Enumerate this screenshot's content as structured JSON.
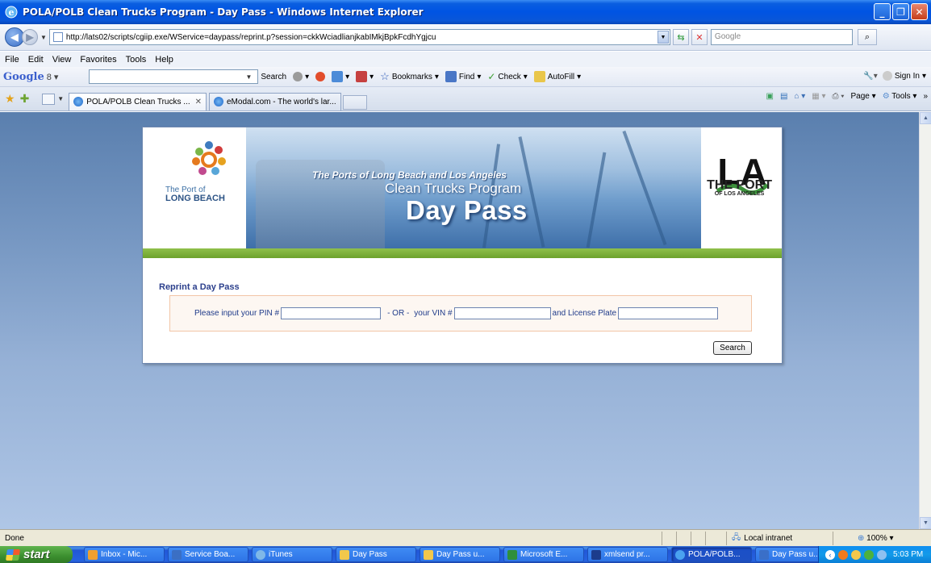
{
  "window": {
    "title": "POLA/POLB Clean Trucks Program - Day Pass - Windows Internet Explorer",
    "controls": [
      "minimize",
      "restore",
      "close"
    ]
  },
  "address": {
    "url": "http://lats02/scripts/cgiip.exe/WService=daypass/reprint.p?session=ckkWciadlianjkabIMkjBpkFcdhYgjcu",
    "search_placeholder": "Google"
  },
  "menu": [
    "File",
    "Edit",
    "View",
    "Favorites",
    "Tools",
    "Help"
  ],
  "google_toolbar": {
    "logo": "Google",
    "items": [
      "Search",
      "Bookmarks",
      "Find",
      "Check",
      "AutoFill"
    ],
    "sign_in": "Sign In"
  },
  "tabs": [
    {
      "label": "POLA/POLB Clean Trucks ...",
      "active": true
    },
    {
      "label": "eModal.com - The world's lar...",
      "active": false
    }
  ],
  "command_bar": [
    "Page",
    "Tools"
  ],
  "banner": {
    "left_logo_line1": "The Port of",
    "left_logo_line2": "LONG BEACH",
    "line1": "The Ports of Long Beach and Los Angeles",
    "line2": "Clean Trucks Program",
    "line3": "Day Pass",
    "right_logo_mark": "LA",
    "right_logo_line1": "THE PORT",
    "right_logo_line2": "OF LOS ANGELES"
  },
  "form": {
    "section_title": "Reprint a Day Pass",
    "pin_label": "Please input your PIN #",
    "or_label": "- OR -",
    "vin_label": "your VIN #",
    "plate_label": "and License Plate",
    "pin_value": "",
    "vin_value": "",
    "plate_value": "",
    "search_button": "Search"
  },
  "status": {
    "text": "Done",
    "zone": "Local intranet",
    "zoom": "100%"
  },
  "taskbar": {
    "start": "start",
    "items": [
      {
        "label": "Inbox - Mic...",
        "color": "#f0a030"
      },
      {
        "label": "Service Boa...",
        "color": "#3b6fc4"
      },
      {
        "label": "iTunes",
        "color": "#7fb8e8"
      },
      {
        "label": "Day Pass",
        "color": "#f2c84b"
      },
      {
        "label": "Day Pass u...",
        "color": "#f2c84b"
      },
      {
        "label": "Microsoft E...",
        "color": "#2f8f3c"
      },
      {
        "label": "xmlsend pr...",
        "color": "#1c3c8c"
      },
      {
        "label": "POLA/POLB...",
        "color": "#4aa2f0",
        "active": true
      },
      {
        "label": "Day Pass u...",
        "color": "#3a6fc8"
      }
    ],
    "clock": "5:03 PM"
  }
}
